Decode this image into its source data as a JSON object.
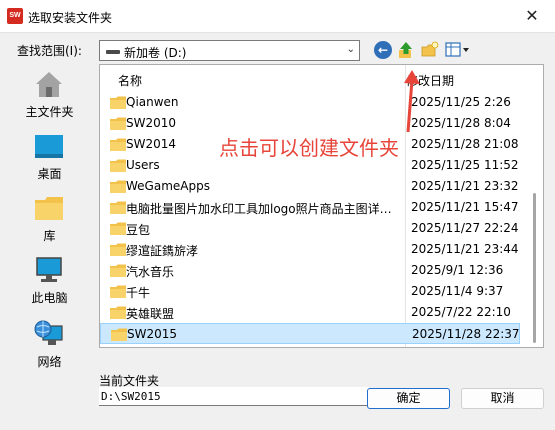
{
  "window": {
    "app_icon_text": "SW",
    "title": "选取安装文件夹",
    "close_glyph": "✕"
  },
  "lookin": {
    "label": "查找范围(I):",
    "value": "新加卷 (D:)"
  },
  "places": [
    {
      "label": "主文件夹",
      "icon": "home-icon"
    },
    {
      "label": "桌面",
      "icon": "desktop-icon"
    },
    {
      "label": "库",
      "icon": "library-icon"
    },
    {
      "label": "此电脑",
      "icon": "computer-icon"
    },
    {
      "label": "网络",
      "icon": "network-icon"
    }
  ],
  "columns": {
    "name": "名称",
    "date": "修改日期"
  },
  "rows": [
    {
      "name": "Qianwen",
      "date": "2025/11/25 2:26"
    },
    {
      "name": "SW2010",
      "date": "2025/11/28 8:04"
    },
    {
      "name": "SW2014",
      "date": "2025/11/28 21:08"
    },
    {
      "name": "Users",
      "date": "2025/11/25 11:52"
    },
    {
      "name": "WeGameApps",
      "date": "2025/11/21 23:32"
    },
    {
      "name": "电脑批量图片加水印工具加logo照片商品主图详情页水印",
      "date": "2025/11/21 15:47"
    },
    {
      "name": "豆包",
      "date": "2025/11/27 22:24"
    },
    {
      "name": "缪逭証鐫旂涍",
      "date": "2025/11/21 23:44"
    },
    {
      "name": "汽水音乐",
      "date": "2025/9/1 12:36"
    },
    {
      "name": "千牛",
      "date": "2025/11/4 9:37"
    },
    {
      "name": "英雄联盟",
      "date": "2025/7/22 22:10"
    },
    {
      "name": "SW2015",
      "date": "2025/11/28 22:37",
      "selected": true
    }
  ],
  "annotation": "点击可以创建文件夹",
  "current_folder": {
    "label": "当前文件夹",
    "value": "D:\\SW2015"
  },
  "buttons": {
    "ok": "确定",
    "cancel": "取消"
  },
  "colors": {
    "annotation": "#e8453a",
    "selection": "#cce8ff",
    "folder": "#f3c24b"
  }
}
